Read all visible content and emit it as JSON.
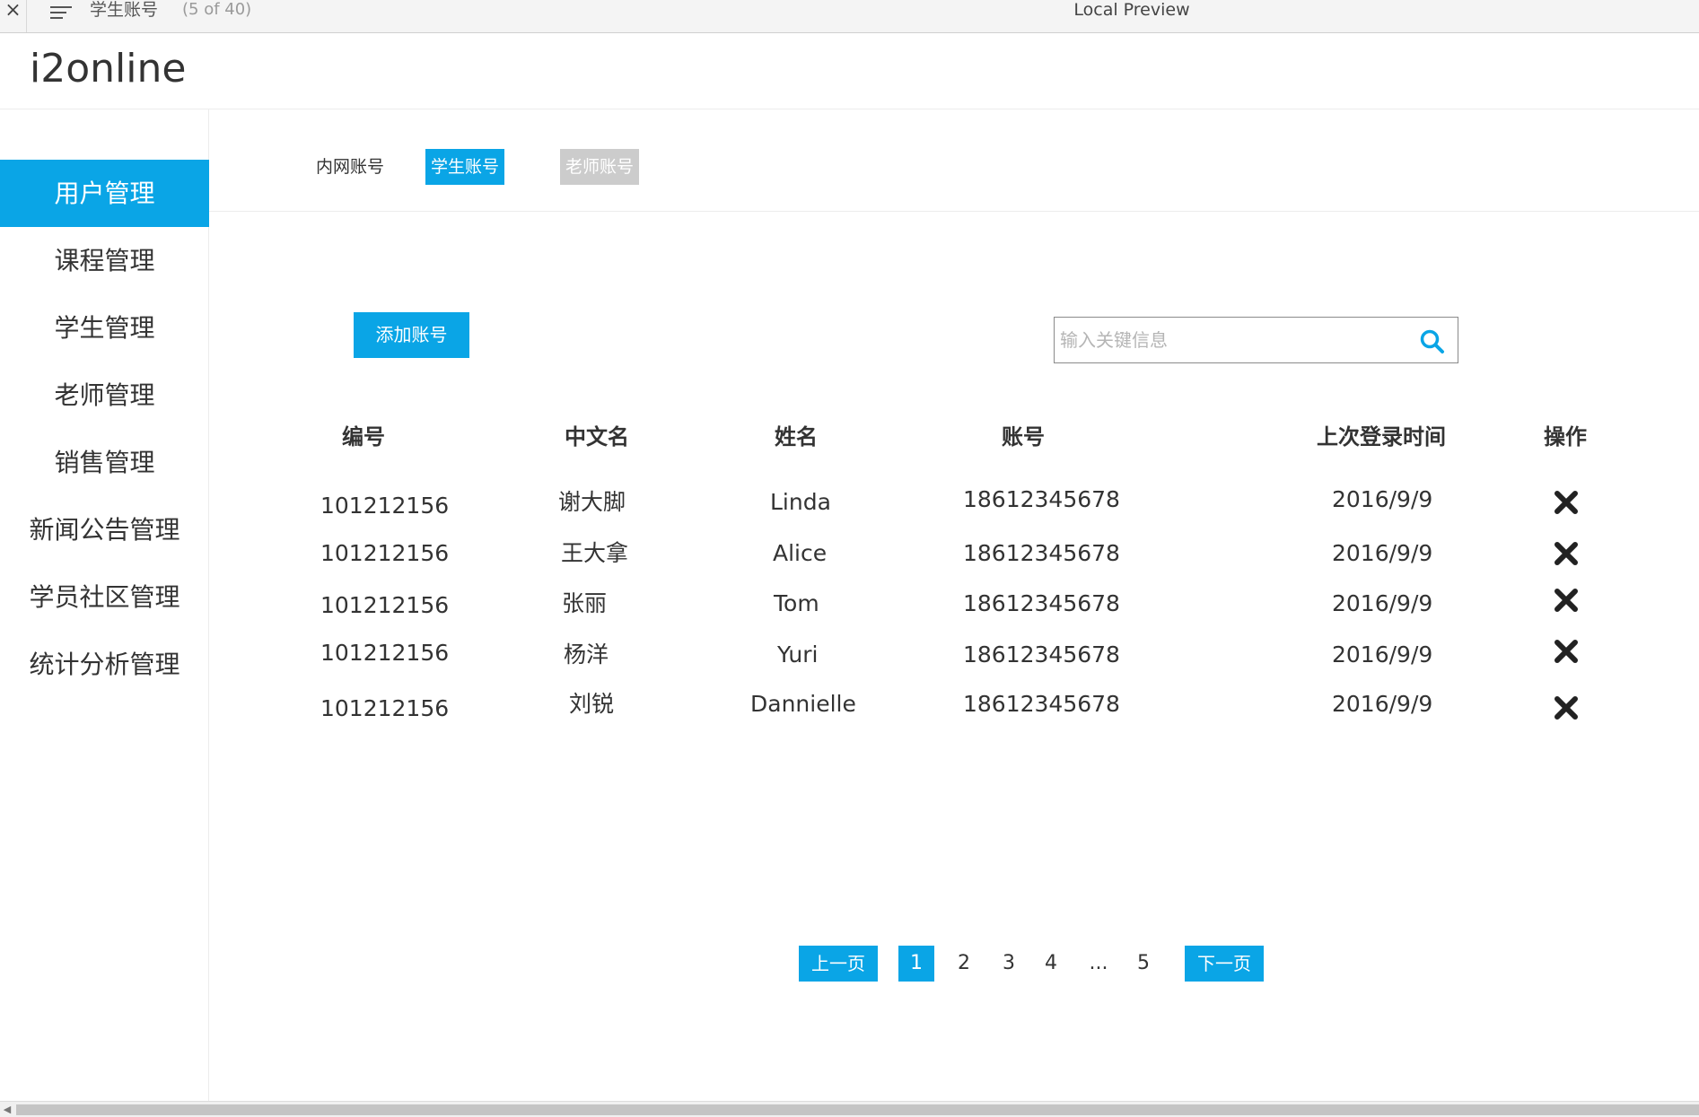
{
  "window": {
    "doc_title": "学生账号",
    "doc_count": "(5 of 40)",
    "window_title": "Local Preview"
  },
  "app": {
    "logo": "i2online"
  },
  "sidebar": {
    "items": [
      {
        "label": "用户管理",
        "active": true
      },
      {
        "label": "课程管理"
      },
      {
        "label": "学生管理"
      },
      {
        "label": "老师管理"
      },
      {
        "label": "销售管理"
      },
      {
        "label": "新闻公告管理"
      },
      {
        "label": "学员社区管理"
      },
      {
        "label": "统计分析管理"
      }
    ]
  },
  "subtabs": [
    {
      "label": "内网账号",
      "state": "plain"
    },
    {
      "label": "学生账号",
      "state": "active"
    },
    {
      "label": "老师账号",
      "state": "disabled"
    }
  ],
  "toolbar": {
    "add_label": "添加账号",
    "search_placeholder": "输入关键信息",
    "search_value": ""
  },
  "table": {
    "headers": [
      "编号",
      "中文名",
      "姓名",
      "账号",
      "上次登录时间",
      "操作"
    ],
    "rows": [
      {
        "id": "101212156",
        "cn_name": "谢大脚",
        "name": "Linda",
        "account": "18612345678",
        "last_login": "2016/9/9"
      },
      {
        "id": "101212156",
        "cn_name": "王大拿",
        "name": "Alice",
        "account": "18612345678",
        "last_login": "2016/9/9"
      },
      {
        "id": "101212156",
        "cn_name": "张丽",
        "name": "Tom",
        "account": "18612345678",
        "last_login": "2016/9/9"
      },
      {
        "id": "101212156",
        "cn_name": "杨洋",
        "name": "Yuri",
        "account": "18612345678",
        "last_login": "2016/9/9"
      },
      {
        "id": "101212156",
        "cn_name": "刘锐",
        "name": "Dannielle",
        "account": "18612345678",
        "last_login": "2016/9/9"
      }
    ]
  },
  "pagination": {
    "prev_label": "上一页",
    "next_label": "下一页",
    "pages": [
      "1",
      "2",
      "3",
      "4",
      "...",
      "5"
    ],
    "current": "1"
  },
  "colors": {
    "accent": "#0aa5e6",
    "disabled_tab": "#cccccc"
  }
}
